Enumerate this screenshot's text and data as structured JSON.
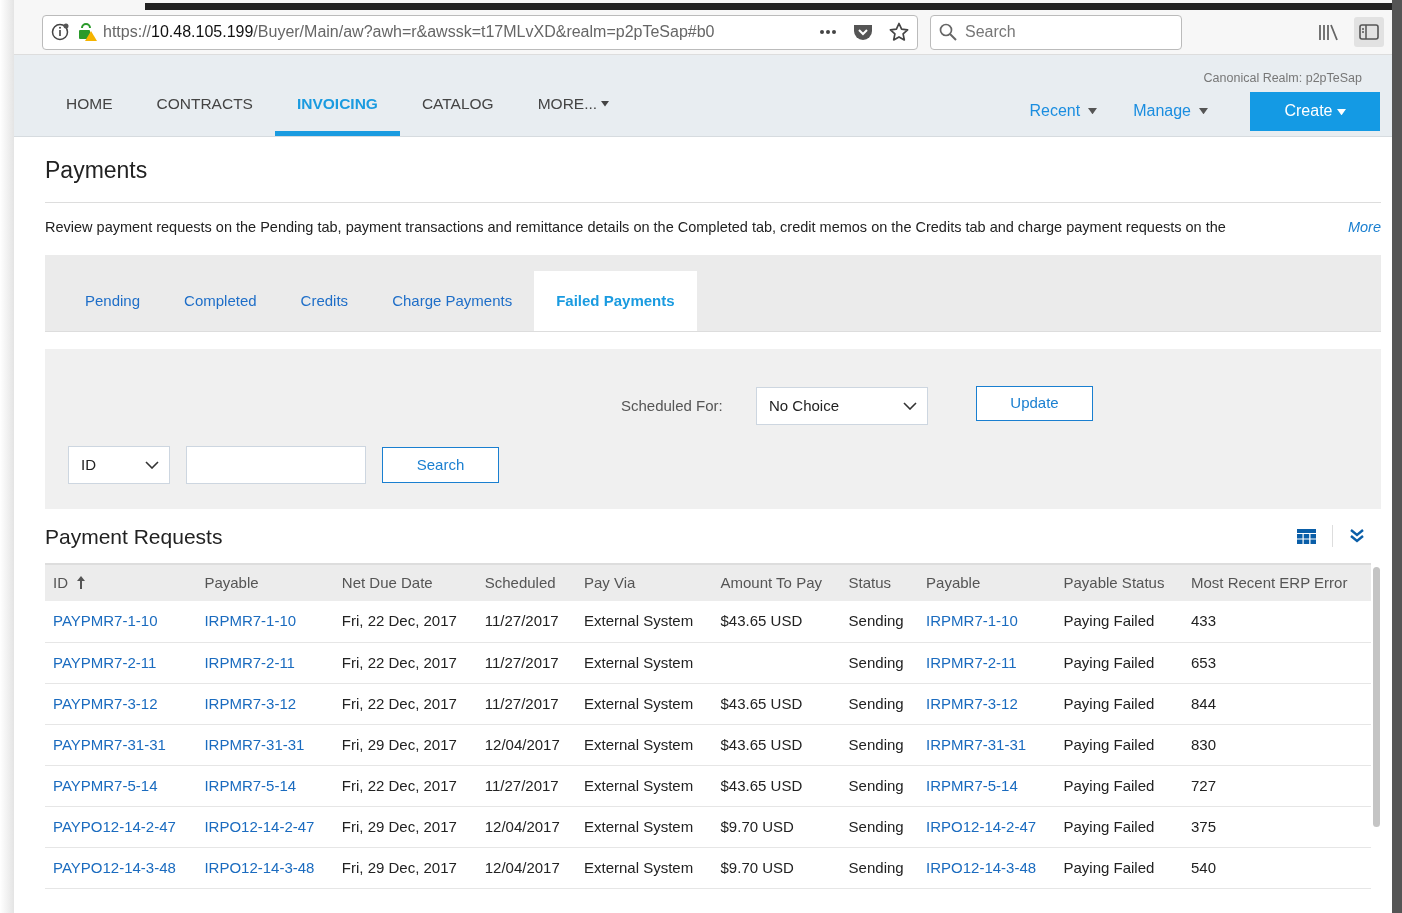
{
  "browser": {
    "url_prefix": "https://",
    "url_host": "10.48.105.199",
    "url_path": "/Buyer/Main/aw?awh=r&awssk=t17MLvXD&realm=p2pTeSap#b0",
    "search_placeholder": "Search"
  },
  "nav": {
    "items": [
      {
        "label": "HOME",
        "selected": false
      },
      {
        "label": "CONTRACTS",
        "selected": false
      },
      {
        "label": "INVOICING",
        "selected": true
      },
      {
        "label": "CATALOG",
        "selected": false
      },
      {
        "label": "MORE...",
        "selected": false,
        "dropdown": true
      }
    ],
    "realm": "Canonical Realm: p2pTeSap",
    "menus": [
      "Recent",
      "Manage"
    ],
    "create": "Create"
  },
  "page": {
    "title": "Payments",
    "description": "Review payment requests on the Pending tab, payment transactions and remittance details on the Completed tab, credit memos on the Credits tab and charge payment requests on the",
    "more": "More"
  },
  "tabs": [
    {
      "label": "Pending",
      "selected": false
    },
    {
      "label": "Completed",
      "selected": false
    },
    {
      "label": "Credits",
      "selected": false
    },
    {
      "label": "Charge Payments",
      "selected": false
    },
    {
      "label": "Failed Payments",
      "selected": true
    }
  ],
  "filter": {
    "scheduled_label": "Scheduled For:",
    "scheduled_value": "No Choice",
    "update": "Update",
    "field_value": "ID",
    "search": "Search"
  },
  "table": {
    "title": "Payment Requests",
    "columns": [
      {
        "label": "ID",
        "kind": "link",
        "sorted": true
      },
      {
        "label": "Payable",
        "kind": "link",
        "sorted": false
      },
      {
        "label": "Net Due Date",
        "kind": "text",
        "sorted": false
      },
      {
        "label": "Scheduled",
        "kind": "text",
        "sorted": false
      },
      {
        "label": "Pay Via",
        "kind": "text",
        "sorted": false
      },
      {
        "label": "Amount To Pay",
        "kind": "text",
        "sorted": false
      },
      {
        "label": "Status",
        "kind": "text",
        "sorted": false
      },
      {
        "label": "Payable",
        "kind": "link",
        "sorted": false
      },
      {
        "label": "Payable Status",
        "kind": "text",
        "sorted": false
      },
      {
        "label": "Most Recent ERP Error",
        "kind": "text",
        "sorted": false
      }
    ],
    "rows": [
      [
        "PAYPMR7-1-10",
        "IRPMR7-1-10",
        "Fri, 22 Dec, 2017",
        "11/27/2017",
        "External System",
        "$43.65 USD",
        "Sending",
        "IRPMR7-1-10",
        "Paying Failed",
        "433"
      ],
      [
        "PAYPMR7-2-11",
        "IRPMR7-2-11",
        "Fri, 22 Dec, 2017",
        "11/27/2017",
        "External System",
        "",
        "Sending",
        "IRPMR7-2-11",
        "Paying Failed",
        "653"
      ],
      [
        "PAYPMR7-3-12",
        "IRPMR7-3-12",
        "Fri, 22 Dec, 2017",
        "11/27/2017",
        "External System",
        "$43.65 USD",
        "Sending",
        "IRPMR7-3-12",
        "Paying Failed",
        "844"
      ],
      [
        "PAYPMR7-31-31",
        "IRPMR7-31-31",
        "Fri, 29 Dec, 2017",
        "12/04/2017",
        "External System",
        "$43.65 USD",
        "Sending",
        "IRPMR7-31-31",
        "Paying Failed",
        "830"
      ],
      [
        "PAYPMR7-5-14",
        "IRPMR7-5-14",
        "Fri, 22 Dec, 2017",
        "11/27/2017",
        "External System",
        "$43.65 USD",
        "Sending",
        "IRPMR7-5-14",
        "Paying Failed",
        "727"
      ],
      [
        "PAYPO12-14-2-47",
        "IRPO12-14-2-47",
        "Fri, 29 Dec, 2017",
        "12/04/2017",
        "External System",
        "$9.70 USD",
        "Sending",
        "IRPO12-14-2-47",
        "Paying Failed",
        "375"
      ],
      [
        "PAYPO12-14-3-48",
        "IRPO12-14-3-48",
        "Fri, 29 Dec, 2017",
        "12/04/2017",
        "External System",
        "$9.70 USD",
        "Sending",
        "IRPO12-14-3-48",
        "Paying Failed",
        "540"
      ]
    ]
  }
}
